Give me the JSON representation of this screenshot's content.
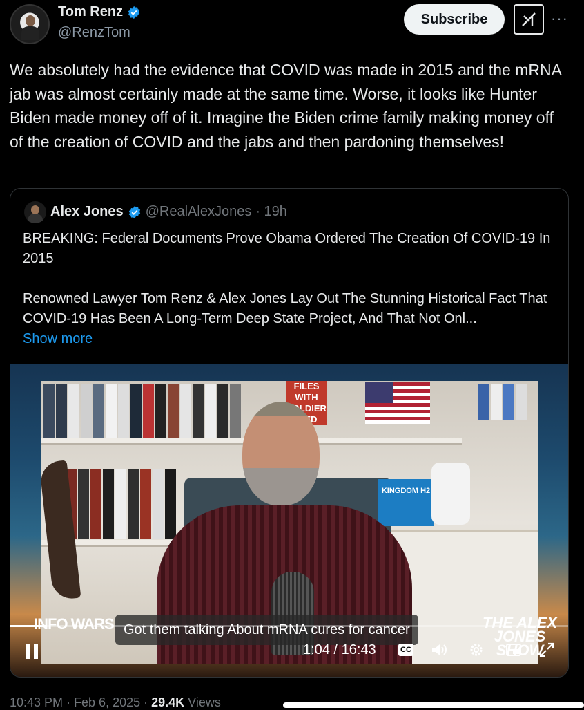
{
  "author": {
    "name": "Tom Renz",
    "handle": "@RenzTom",
    "subscribe_label": "Subscribe",
    "more_label": "···"
  },
  "tweet": {
    "text": "We absolutely had the evidence that COVID was made in 2015 and the mRNA jab was almost certainly made at the same time. Worse, it looks like Hunter Biden made money off of it. Imagine the Biden crime family making money off of the creation of COVID and the jabs and then pardoning themselves!"
  },
  "quote": {
    "name": "Alex Jones",
    "handle": "@RealAlexJones",
    "time": "· 19h",
    "line1": "BREAKING: Federal Documents Prove Obama Ordered The Creation Of COVID-19 In 2015",
    "line2": "Renowned Lawyer Tom Renz & Alex Jones Lay Out The Stunning Historical Fact That COVID-19 Has Been A Long-Term Deep State Project, And That Not Onl...",
    "show_more": "Show more"
  },
  "video": {
    "caption": "Got them talking About mRNA cures for cancer",
    "time": "1:04 / 16:43",
    "progress": 0.065,
    "cc_label": "CC",
    "poster_text": "FILES WITH SOLDIER DIED",
    "product_label": "KINGDOM H2",
    "logo_left": "INFO WARS",
    "logo_right": "THE ALEX JONES SHOW"
  },
  "footer": {
    "timestamp": "10:43 PM · Feb 6, 2025 · ",
    "views_count": "29.4K",
    "views_label": " Views"
  },
  "colors": {
    "link": "#1d9bf0",
    "verified": "#1d9bf0",
    "muted": "#71767b"
  }
}
